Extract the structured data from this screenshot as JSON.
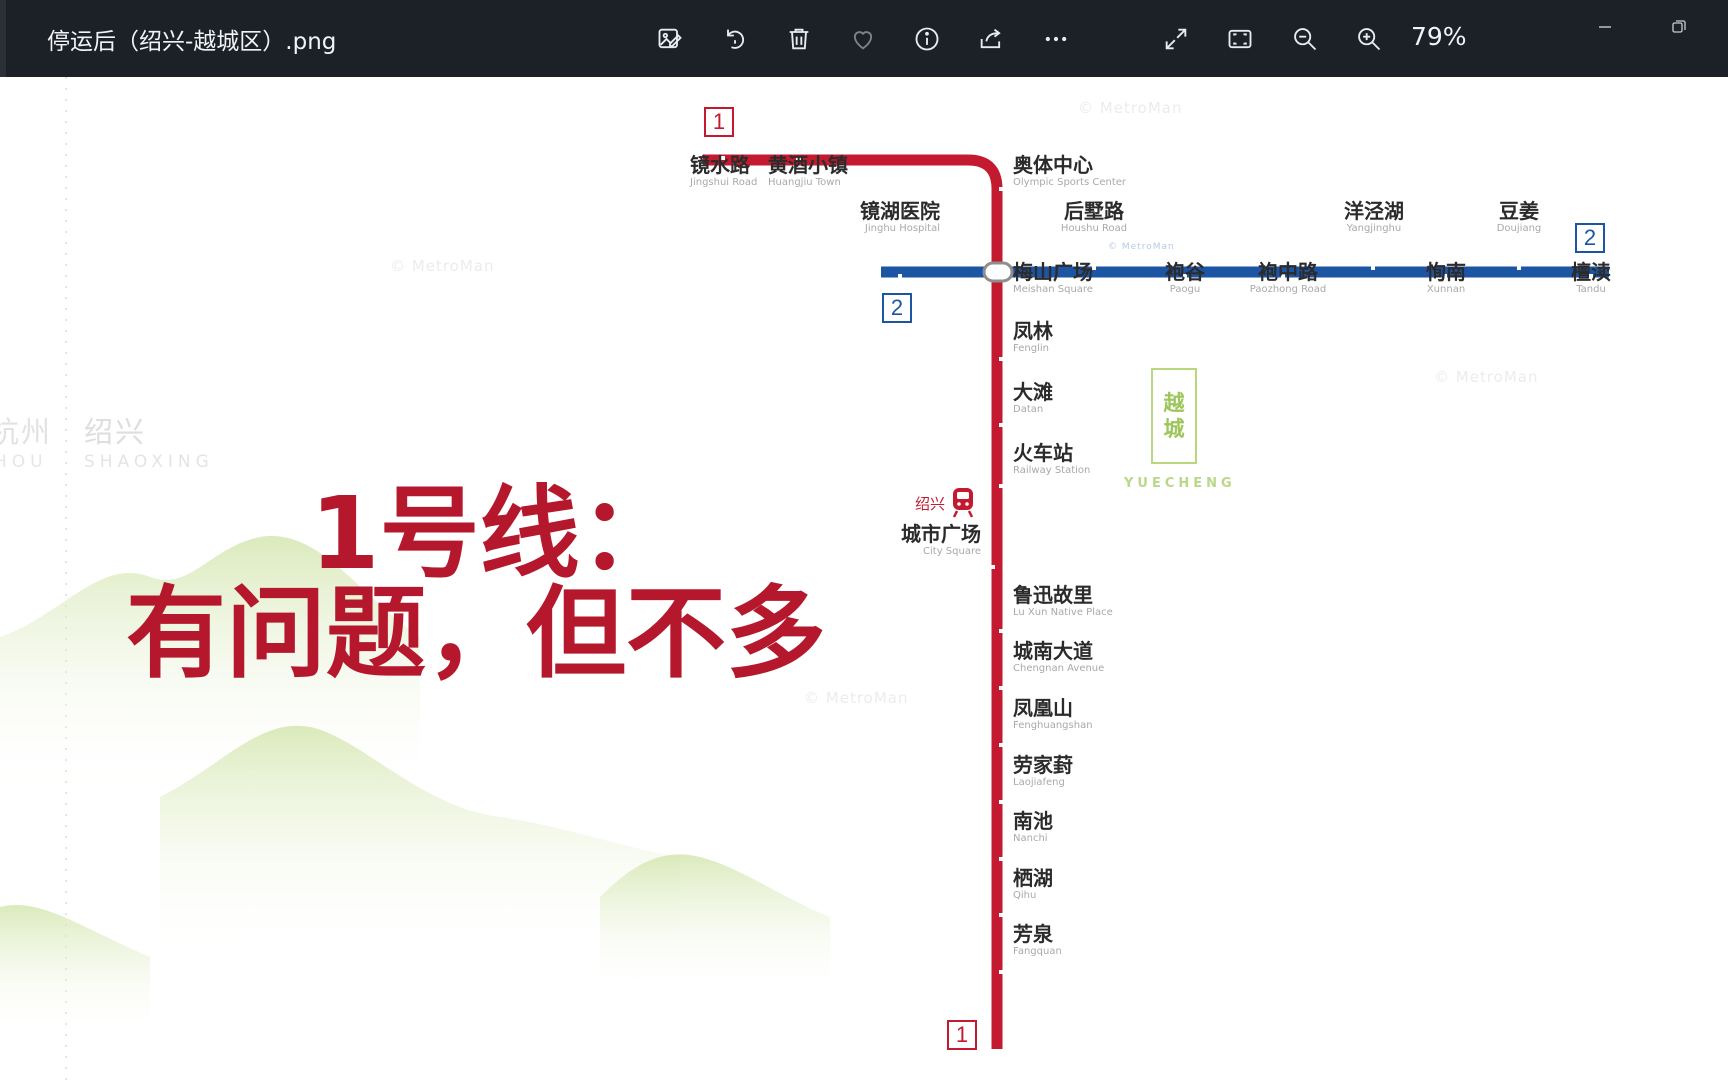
{
  "window": {
    "title": "停运后（绍兴-越城区）.png",
    "zoom": "79%",
    "toolbar_icons": [
      "edit-image-icon",
      "rotate-icon",
      "delete-icon",
      "favorite-heart-icon",
      "info-icon",
      "share-icon",
      "more-icon",
      "fullscreen-icon",
      "fit-window-icon",
      "zoom-out-icon",
      "zoom-in-icon"
    ],
    "window_controls": [
      "minimize-icon",
      "restore-icon"
    ]
  },
  "image": {
    "watermark": "© MetroMan",
    "city": {
      "zh": "绍兴",
      "en": "SHAOXING"
    },
    "prev_city": {
      "zh": "杭州",
      "en": "HOU"
    },
    "district": {
      "zh_1": "越",
      "zh_2": "城",
      "en": "YUECHENG"
    },
    "headline": {
      "line1": "1号线：",
      "line2": "有问题，但不多"
    },
    "railway_hub_label": "绍兴",
    "badges": {
      "line1": "1",
      "line2": "2"
    },
    "colors": {
      "line1": "#c41a30",
      "line2": "#1c55a4",
      "district": "#9cc55a",
      "headline": "#b5182c"
    },
    "line1_stations": [
      {
        "zh": "镜水路",
        "en": "Jingshui Road"
      },
      {
        "zh": "黄酒小镇",
        "en": "Huangjiu Town"
      },
      {
        "zh": "奥体中心",
        "en": "Olympic Sports Center"
      },
      {
        "zh": "梅山广场",
        "en": "Meishan Square"
      },
      {
        "zh": "凤林",
        "en": "Fenglin"
      },
      {
        "zh": "大滩",
        "en": "Datan"
      },
      {
        "zh": "火车站",
        "en": "Railway Station"
      },
      {
        "zh": "城市广场",
        "en": "City Square"
      },
      {
        "zh": "鲁迅故里",
        "en": "Lu Xun Native Place"
      },
      {
        "zh": "城南大道",
        "en": "Chengnan Avenue"
      },
      {
        "zh": "凤凰山",
        "en": "Fenghuangshan"
      },
      {
        "zh": "劳家葑",
        "en": "Laojiafeng"
      },
      {
        "zh": "南池",
        "en": "Nanchi"
      },
      {
        "zh": "栖湖",
        "en": "Qihu"
      },
      {
        "zh": "芳泉",
        "en": "Fangquan"
      }
    ],
    "line2_stations": [
      {
        "zh": "镜湖医院",
        "en": "Jinghu Hospital"
      },
      {
        "zh": "后墅路",
        "en": "Houshu Road"
      },
      {
        "zh": "袍谷",
        "en": "Paogu"
      },
      {
        "zh": "袍中路",
        "en": "Paozhong Road"
      },
      {
        "zh": "洋泾湖",
        "en": "Yangjinghu"
      },
      {
        "zh": "恂南",
        "en": "Xunnan"
      },
      {
        "zh": "豆姜",
        "en": "Doujiang"
      },
      {
        "zh": "檀渎",
        "en": "Tandu"
      }
    ]
  }
}
